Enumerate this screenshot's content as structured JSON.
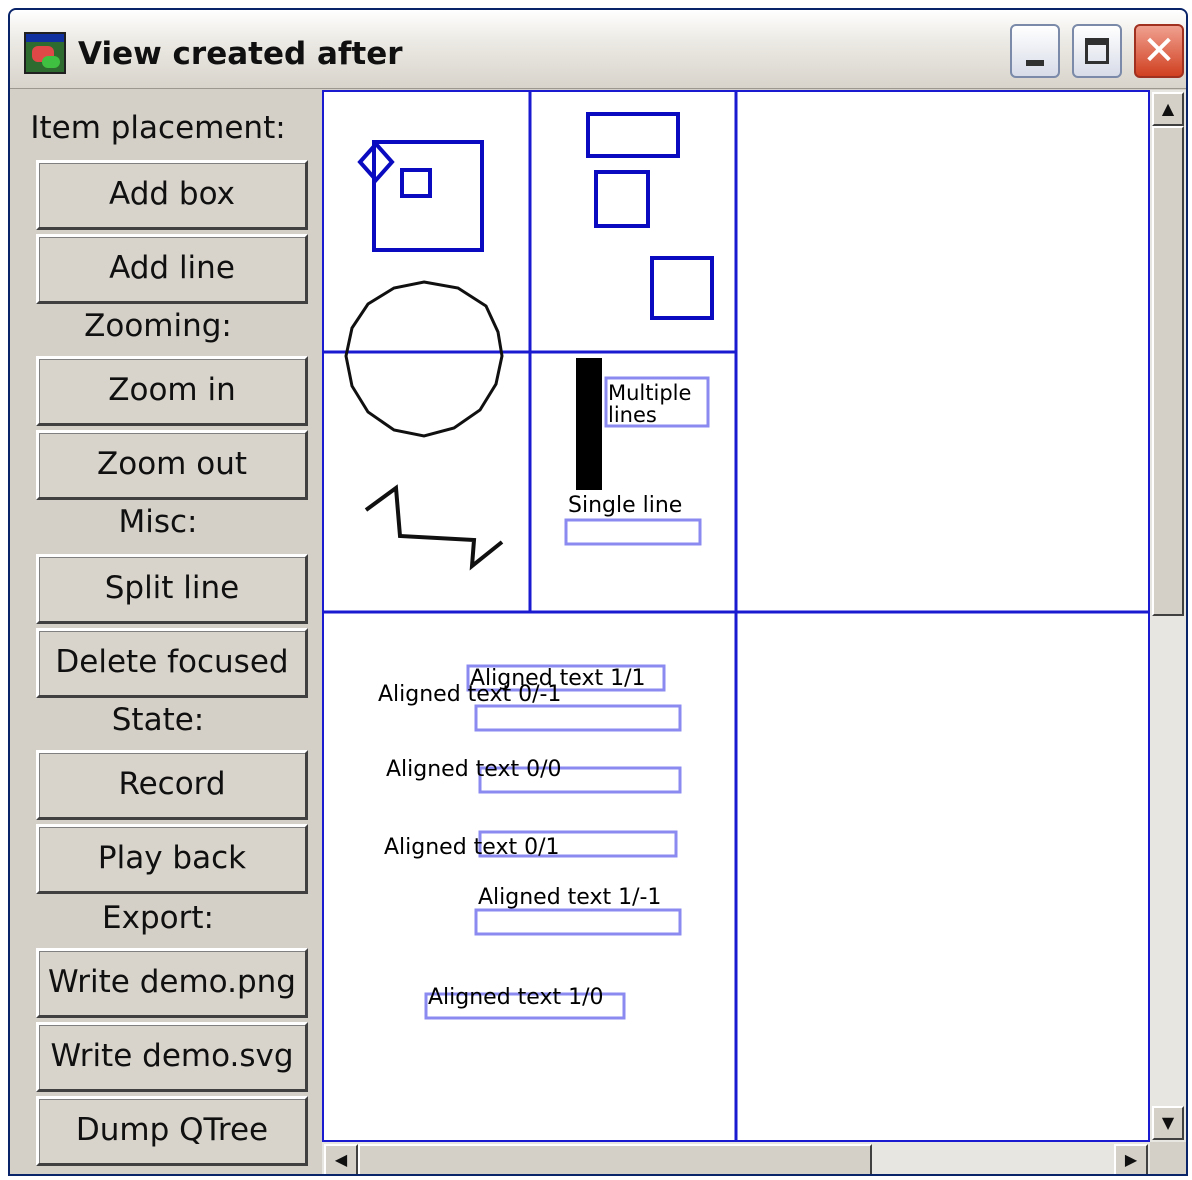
{
  "window": {
    "title": "View created after"
  },
  "icons": {
    "app": "app-icon",
    "minimize": "minimize-icon",
    "maximize": "maximize-icon",
    "close": "close-icon",
    "scroll_up": "arrow-up-icon",
    "scroll_down": "arrow-down-icon",
    "scroll_left": "arrow-left-icon",
    "scroll_right": "arrow-right-icon"
  },
  "panel": {
    "item_placement_label": "Item placement:",
    "add_box": "Add box",
    "add_line": "Add line",
    "zooming_label": "Zooming:",
    "zoom_in": "Zoom in",
    "zoom_out": "Zoom out",
    "misc_label": "Misc:",
    "split_line": "Split line",
    "delete_focused": "Delete focused",
    "state_label": "State:",
    "record": "Record",
    "play_back": "Play back",
    "export_label": "Export:",
    "write_png": "Write demo.png",
    "write_svg": "Write demo.svg",
    "dump_qtree": "Dump QTree"
  },
  "canvas": {
    "text_multiple_line1": "Multiple",
    "text_multiple_line2": "lines",
    "text_single_line": "Single line",
    "aligned": {
      "t11": "Aligned text 1/1",
      "t0m1": "Aligned text 0/-1",
      "t00": "Aligned text 0/0",
      "t01": "Aligned text 0/1",
      "t1m1": "Aligned text 1/-1",
      "t10": "Aligned text 1/0"
    }
  },
  "colors": {
    "grid_line": "#1a1ad0",
    "box_outline": "#0a0ac0",
    "text_box_outline": "#8a8af0",
    "window_bg": "#d4d0c8"
  },
  "scrollbars": {
    "vertical_thumb_fraction": 0.5,
    "horizontal_thumb_fraction": 0.68
  }
}
